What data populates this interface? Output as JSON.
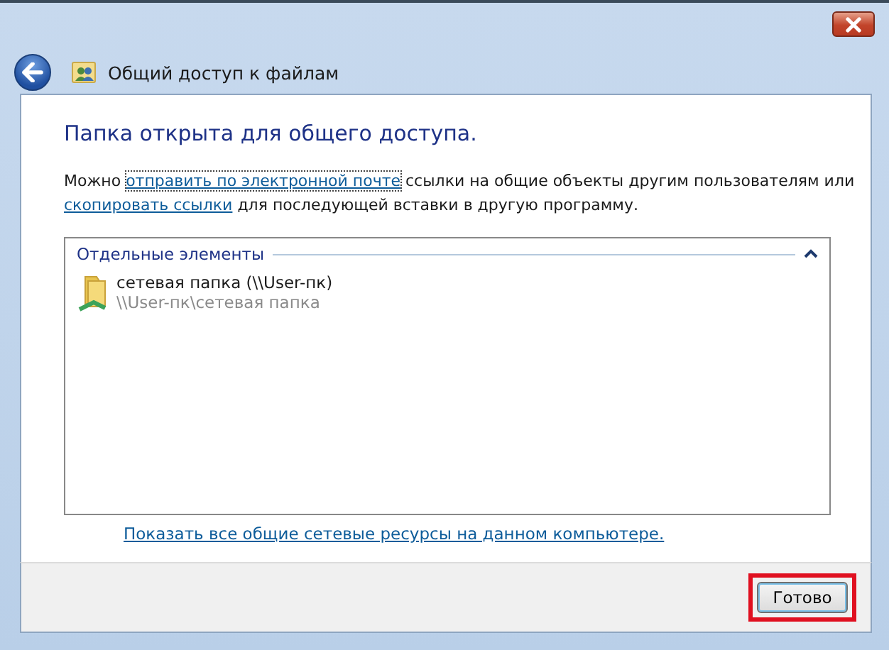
{
  "window": {
    "title": "Общий доступ к файлам"
  },
  "heading": "Папка открыта для общего доступа.",
  "message": [
    {
      "kind": "text",
      "text": "Можно "
    },
    {
      "kind": "link",
      "text": "отправить по электронной почте",
      "focused": true
    },
    {
      "kind": "text",
      "text": " ссылки на общие объекты другим пользователям или "
    },
    {
      "kind": "link",
      "text": "скопировать ссылки",
      "focused": false
    },
    {
      "kind": "text",
      "text": " для последующей вставки в другую программу."
    }
  ],
  "group": {
    "title": "Отдельные элементы",
    "expanded": true,
    "items": [
      {
        "name": "сетевая папка (\\\\User-пк)",
        "path": "\\\\User-пк\\сетевая папка"
      }
    ]
  },
  "show_all_link": "Показать все общие сетевые ресурсы на данном компьютере.",
  "buttons": [
    {
      "label": "Готово",
      "highlighted": true
    }
  ]
}
